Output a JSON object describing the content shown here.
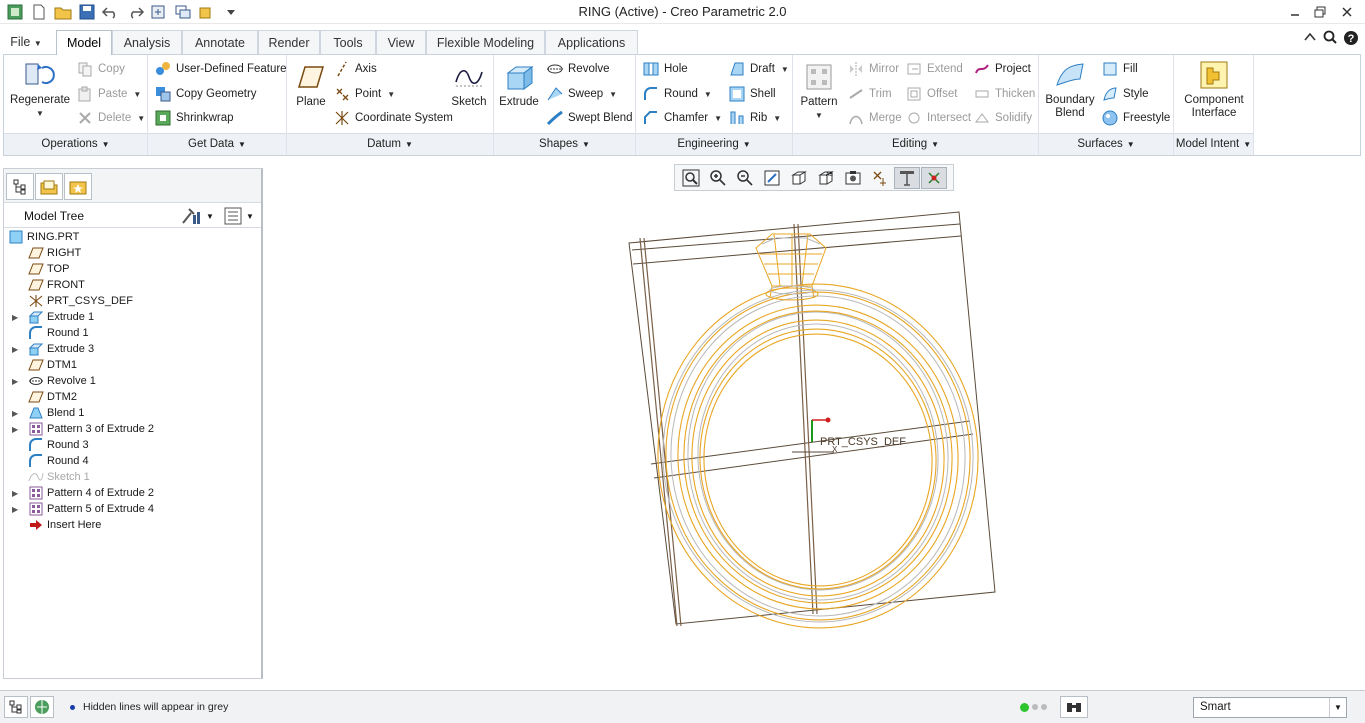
{
  "window": {
    "title": "RING (Active) - Creo Parametric 2.0"
  },
  "tabs": [
    {
      "label": "File",
      "file": true
    },
    {
      "label": "Model",
      "active": true
    },
    {
      "label": "Analysis"
    },
    {
      "label": "Annotate"
    },
    {
      "label": "Render"
    },
    {
      "label": "Tools"
    },
    {
      "label": "View"
    },
    {
      "label": "Flexible Modeling"
    },
    {
      "label": "Applications"
    }
  ],
  "ribbon": {
    "operations": {
      "label": "Operations",
      "regenerate": "Regenerate",
      "copy": "Copy",
      "paste": "Paste",
      "delete": "Delete"
    },
    "get_data": {
      "label": "Get Data",
      "udf": "User-Defined Feature",
      "copy_geometry": "Copy Geometry",
      "shrinkwrap": "Shrinkwrap"
    },
    "datum": {
      "label": "Datum",
      "plane": "Plane",
      "axis": "Axis",
      "point": "Point",
      "csys": "Coordinate System",
      "sketch": "Sketch"
    },
    "shapes": {
      "label": "Shapes",
      "extrude": "Extrude",
      "revolve": "Revolve",
      "sweep": "Sweep",
      "swept_blend": "Swept Blend"
    },
    "engineering": {
      "label": "Engineering",
      "hole": "Hole",
      "round": "Round",
      "chamfer": "Chamfer",
      "draft": "Draft",
      "shell": "Shell",
      "rib": "Rib"
    },
    "editing": {
      "label": "Editing",
      "pattern": "Pattern",
      "mirror": "Mirror",
      "trim": "Trim",
      "merge": "Merge",
      "extend": "Extend",
      "offset": "Offset",
      "intersect": "Intersect",
      "project": "Project",
      "thicken": "Thicken",
      "solidify": "Solidify"
    },
    "surfaces": {
      "label": "Surfaces",
      "boundary_blend_1": "Boundary",
      "boundary_blend_2": "Blend",
      "fill": "Fill",
      "style": "Style",
      "freestyle": "Freestyle"
    },
    "model_intent": {
      "label": "Model Intent",
      "component_interface_1": "Component",
      "component_interface_2": "Interface"
    }
  },
  "model_tree": {
    "title": "Model Tree",
    "items": [
      {
        "label": "RING.PRT",
        "icon": "part-icon",
        "root": true
      },
      {
        "label": "RIGHT",
        "icon": "datum-plane-icon"
      },
      {
        "label": "TOP",
        "icon": "datum-plane-icon"
      },
      {
        "label": "FRONT",
        "icon": "datum-plane-icon"
      },
      {
        "label": "PRT_CSYS_DEF",
        "icon": "csys-icon"
      },
      {
        "label": "Extrude 1",
        "icon": "extrude-icon",
        "expandable": true
      },
      {
        "label": "Round 1",
        "icon": "round-icon"
      },
      {
        "label": "Extrude 3",
        "icon": "extrude-icon",
        "expandable": true
      },
      {
        "label": "DTM1",
        "icon": "datum-plane-icon"
      },
      {
        "label": "Revolve 1",
        "icon": "revolve-icon",
        "expandable": true
      },
      {
        "label": "DTM2",
        "icon": "datum-plane-icon"
      },
      {
        "label": "Blend 1",
        "icon": "blend-icon",
        "expandable": true
      },
      {
        "label": "Pattern 3 of Extrude 2",
        "icon": "pattern-icon",
        "expandable": true
      },
      {
        "label": "Round 3",
        "icon": "round-icon"
      },
      {
        "label": "Round 4",
        "icon": "round-icon"
      },
      {
        "label": "Sketch 1",
        "icon": "sketch-icon",
        "disabled": true
      },
      {
        "label": "Pattern 4 of Extrude 2",
        "icon": "pattern-icon",
        "expandable": true
      },
      {
        "label": "Pattern 5 of Extrude 4",
        "icon": "pattern-icon",
        "expandable": true
      },
      {
        "label": "Insert Here",
        "icon": "insert-arrow-icon"
      }
    ]
  },
  "graphics": {
    "csys_label": "PRT_CSYS_DEF",
    "x_label": "X"
  },
  "status": {
    "message": "Hidden lines will appear in grey",
    "filter": "Smart"
  },
  "colors": {
    "accent_tab_border": "#b9c3ce",
    "ring": "#e8a623",
    "hidden": "#b8b8b8"
  }
}
